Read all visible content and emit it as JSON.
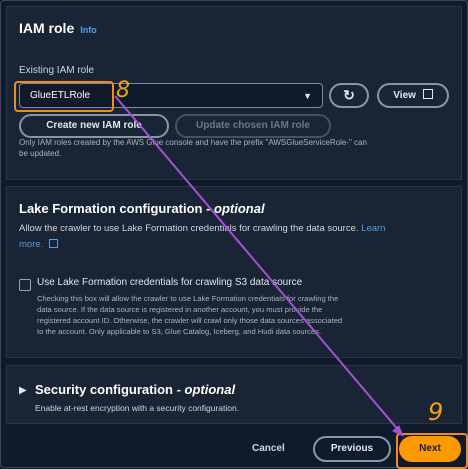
{
  "iam": {
    "title": "IAM role",
    "info": "Info",
    "existing_label": "Existing IAM role",
    "selected_role": "GlueETLRole",
    "view_label": "View",
    "create_label": "Create new IAM role",
    "update_label": "Update chosen IAM role",
    "note_line1": "Only IAM roles created by the AWS Glue console and have the prefix \"AWSGlueServiceRole-\" can",
    "note_line2": "be updated."
  },
  "lake": {
    "title": "Lake Formation configuration",
    "optional": "optional",
    "desc_line1": "Allow the crawler to use Lake Formation credentials for crawling the data source.",
    "learn_more_a": "Learn",
    "learn_more_b": "more.",
    "checkbox_label": "Use Lake Formation credentials for crawling S3 data source",
    "checkbox_desc": [
      "Checking this box will allow the crawler to use Lake Formation credentials for crawling the",
      "data source. If the data source is registered in another account, you must provide the",
      "registered account ID. Otherwise, the crawler will crawl only those data sources associated",
      "to the account. Only applicable to S3, Glue Catalog, Iceberg, and Hudi data sources."
    ]
  },
  "security": {
    "title": "Security configuration",
    "optional": "optional",
    "desc": "Enable at-rest encryption with a security configuration."
  },
  "footer": {
    "cancel": "Cancel",
    "previous": "Previous",
    "next": "Next"
  },
  "annotations": {
    "step8": "8",
    "step9": "9"
  },
  "colors": {
    "accent": "#f08a24",
    "annotation": "#f6a00c",
    "arrow": "#a84fd8",
    "link": "#539fe5"
  }
}
